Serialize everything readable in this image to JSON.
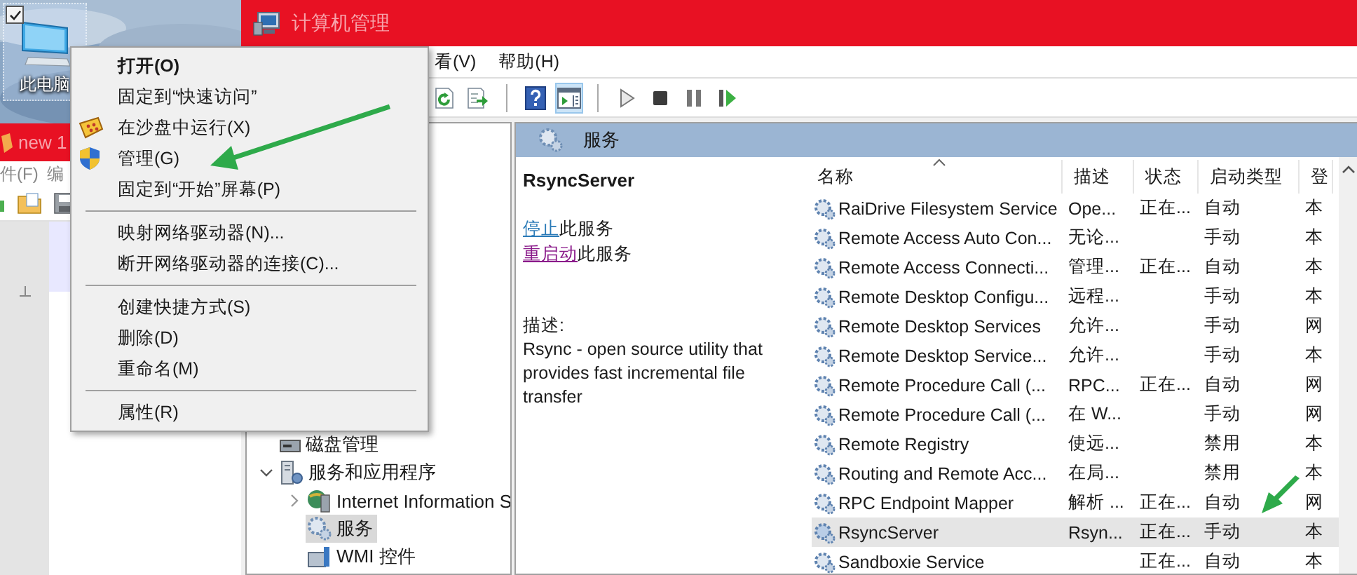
{
  "desktop": {
    "icon_label": "此电脑",
    "checked": true
  },
  "editor_window": {
    "title": "new 1",
    "menu": [
      "件(F)",
      "编"
    ]
  },
  "window": {
    "title": "计算机管理",
    "menu": [
      "看(V)",
      "帮助(H)"
    ]
  },
  "toolbar": [
    {
      "kind": "refresh",
      "pressed": false
    },
    {
      "kind": "export",
      "pressed": false
    },
    {
      "kind": "separator"
    },
    {
      "kind": "help",
      "pressed": false
    },
    {
      "kind": "action-pane",
      "pressed": true
    },
    {
      "kind": "separator"
    },
    {
      "kind": "play",
      "pressed": false
    },
    {
      "kind": "stop",
      "pressed": false
    },
    {
      "kind": "pause",
      "pressed": false
    },
    {
      "kind": "resume",
      "pressed": false
    }
  ],
  "tree": [
    {
      "label": "磁盘管理",
      "kind": "disk",
      "selected": false
    },
    {
      "label": "服务和应用程序",
      "kind": "apps",
      "selected": false,
      "expanded": true,
      "children": [
        {
          "label": "Internet Information S",
          "kind": "iis",
          "selected": false,
          "expanded": false
        },
        {
          "label": "服务",
          "kind": "gear",
          "selected": true
        },
        {
          "label": "WMI 控件",
          "kind": "wmi",
          "selected": false
        }
      ]
    }
  ],
  "panel": {
    "title": "服务"
  },
  "details": {
    "service_name": "RsyncServer",
    "actions": [
      {
        "link": "停止",
        "text": "此服务",
        "visited": false
      },
      {
        "link": "重启动",
        "text": "此服务",
        "visited": true
      }
    ],
    "description_label": "描述:",
    "description": "Rsync - open source utility that provides fast incremental file transfer"
  },
  "table": {
    "columns": [
      "名称",
      "描述",
      "状态",
      "启动类型",
      "登"
    ],
    "rows": [
      {
        "name": "RaiDrive Filesystem Service",
        "description": "Ope...",
        "status": "正在...",
        "startup": "自动",
        "logon": "本",
        "selected": false
      },
      {
        "name": "Remote Access Auto Con...",
        "description": "无论...",
        "startup": "手动",
        "logon": "本",
        "selected": false
      },
      {
        "name": "Remote Access Connecti...",
        "description": "管理...",
        "status": "正在...",
        "startup": "自动",
        "logon": "本",
        "selected": false
      },
      {
        "name": "Remote Desktop Configu...",
        "description": "远程...",
        "startup": "手动",
        "logon": "本",
        "selected": false
      },
      {
        "name": "Remote Desktop Services",
        "description": "允许...",
        "startup": "手动",
        "logon": "网",
        "selected": false
      },
      {
        "name": "Remote Desktop Service...",
        "description": "允许...",
        "startup": "手动",
        "logon": "本",
        "selected": false
      },
      {
        "name": "Remote Procedure Call (...",
        "description": "RPC...",
        "status": "正在...",
        "startup": "自动",
        "logon": "网",
        "selected": false
      },
      {
        "name": "Remote Procedure Call (...",
        "description": "在 W...",
        "startup": "手动",
        "logon": "网",
        "selected": false
      },
      {
        "name": "Remote Registry",
        "description": "使远...",
        "startup": "禁用",
        "logon": "本",
        "selected": false
      },
      {
        "name": "Routing and Remote Acc...",
        "description": "在局...",
        "startup": "禁用",
        "logon": "本",
        "selected": false
      },
      {
        "name": "RPC Endpoint Mapper",
        "description": "解析 ...",
        "status": "正在...",
        "startup": "自动",
        "logon": "网",
        "selected": false
      },
      {
        "name": "RsyncServer",
        "description": "Rsyn...",
        "status": "正在...",
        "startup": "手动",
        "logon": "本",
        "selected": true
      },
      {
        "name": "Sandboxie Service",
        "status": "正在...",
        "startup": "自动",
        "logon": "本",
        "selected": false
      }
    ]
  },
  "context_menu": {
    "items": [
      {
        "kind": "item",
        "label": "打开(O)",
        "bold": true
      },
      {
        "kind": "item",
        "label": "固定到“快速访问”",
        "bold": false
      },
      {
        "kind": "sandbox",
        "label": "在沙盘中运行(X)",
        "bold": false
      },
      {
        "kind": "shield",
        "label": "管理(G)",
        "bold": false
      },
      {
        "kind": "item",
        "label": "固定到“开始”屏幕(P)",
        "bold": false
      },
      {
        "kind": "separator"
      },
      {
        "kind": "item",
        "label": "映射网络驱动器(N)...",
        "bold": false
      },
      {
        "kind": "item",
        "label": "断开网络驱动器的连接(C)...",
        "bold": false
      },
      {
        "kind": "separator"
      },
      {
        "kind": "item",
        "label": "创建快捷方式(S)",
        "bold": false
      },
      {
        "kind": "item",
        "label": "删除(D)",
        "bold": false
      },
      {
        "kind": "item",
        "label": "重命名(M)",
        "bold": false
      },
      {
        "kind": "separator"
      },
      {
        "kind": "item",
        "label": "属性(R)",
        "bold": false
      }
    ]
  }
}
